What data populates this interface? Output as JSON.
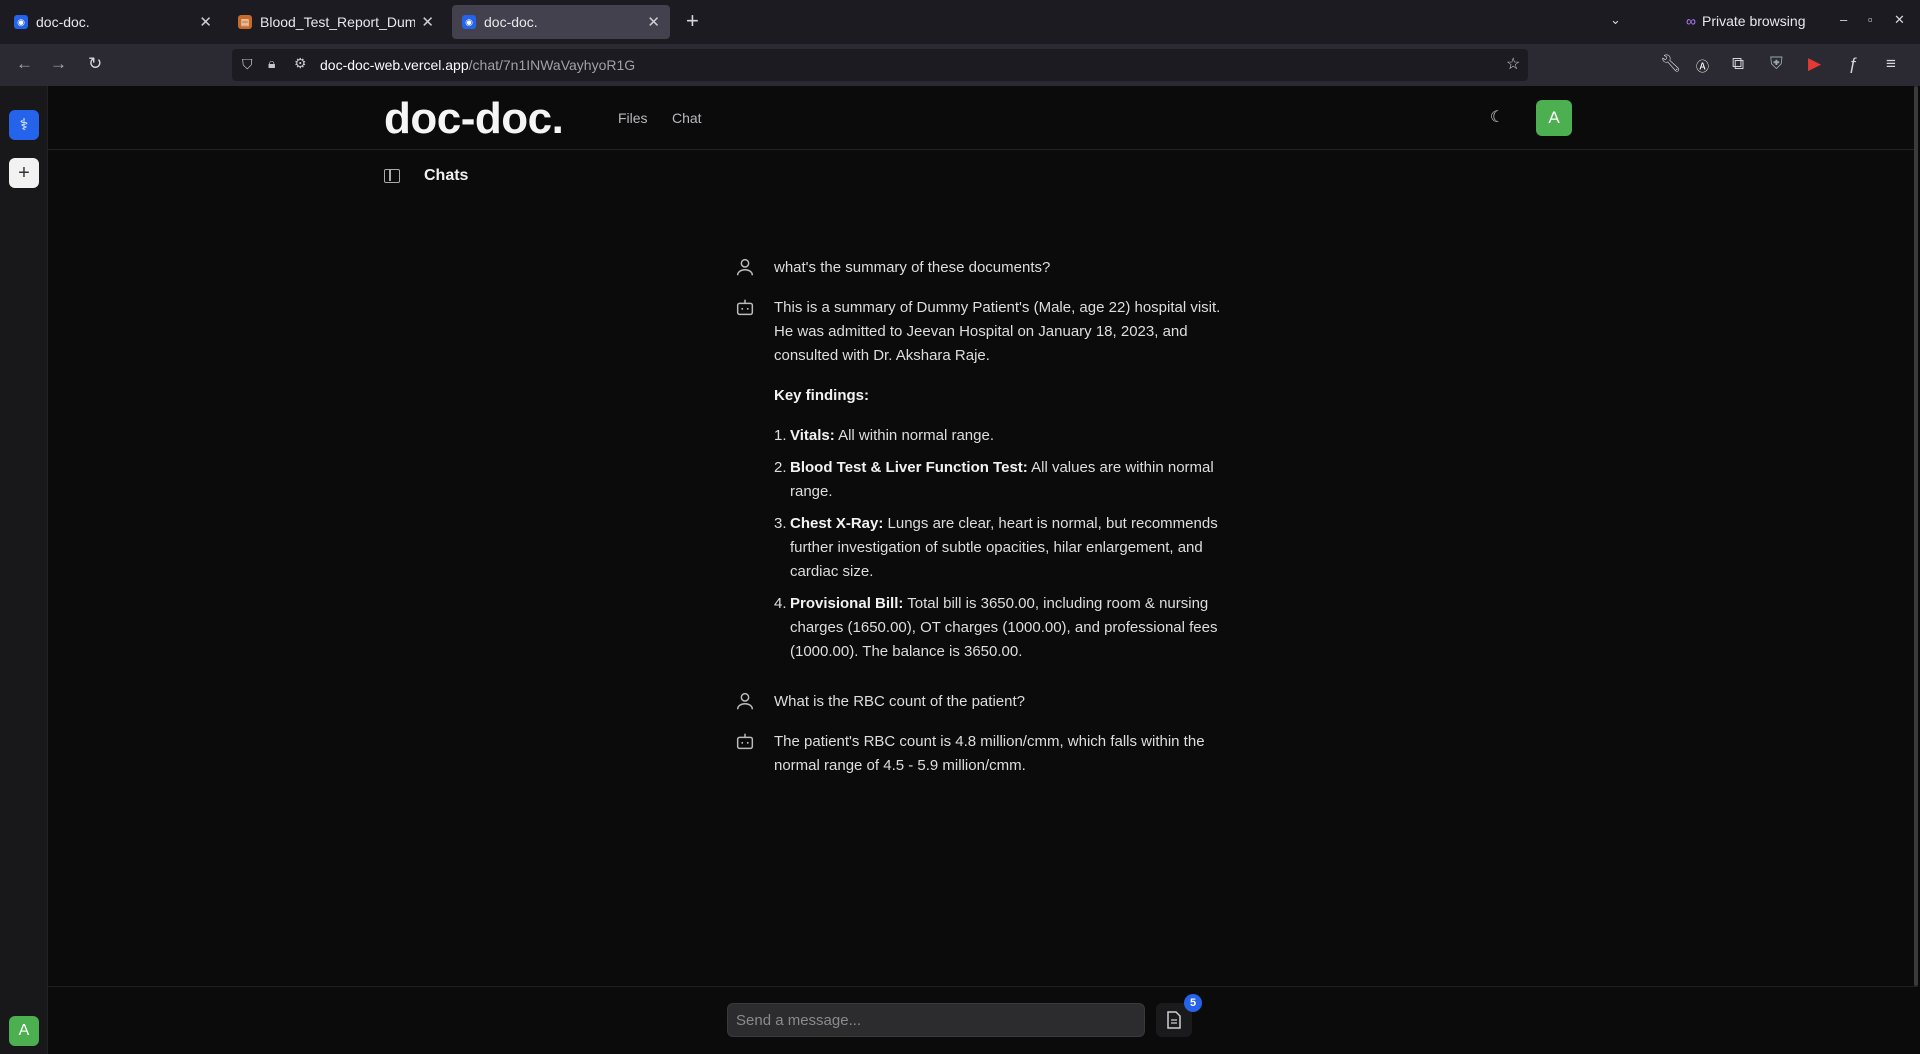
{
  "browser": {
    "tabs": [
      {
        "title": "doc-doc.",
        "active": false
      },
      {
        "title": "Blood_Test_Report_Dum",
        "active": false
      },
      {
        "title": "doc-doc.",
        "active": true
      }
    ],
    "new_tab": "+",
    "private_label": "Private browsing",
    "url_host": "doc-doc-web.vercel.app",
    "url_path": "/chat/7n1INWaVayhyoR1G"
  },
  "rail": {
    "add_label": "+",
    "user_initial": "A"
  },
  "app": {
    "brand": "doc-doc.",
    "nav": {
      "files": "Files",
      "chat": "Chat"
    },
    "avatar_initial": "A",
    "chats_title": "Chats"
  },
  "messages": [
    {
      "role": "user",
      "text": "what's the summary of these documents?"
    },
    {
      "role": "assistant",
      "intro": "This is a summary of Dummy Patient's (Male, age 22) hospital visit. He was admitted to Jeevan Hospital on January 18, 2023, and consulted with Dr. Akshara Raje.",
      "heading": "Key findings:",
      "items": [
        {
          "num": "1.",
          "label": "Vitals:",
          "text": " All within normal range."
        },
        {
          "num": "2.",
          "label": "Blood Test & Liver Function Test:",
          "text": " All values are within normal range."
        },
        {
          "num": "3.",
          "label": "Chest X-Ray:",
          "text": " Lungs are clear, heart is normal, but recommends further investigation of subtle opacities, hilar enlargement, and cardiac size."
        },
        {
          "num": "4.",
          "label": "Provisional Bill:",
          "text": " Total bill is 3650.00, including room & nursing charges (1650.00), OT charges (1000.00), and professional fees (1000.00). The balance is 3650.00."
        }
      ]
    },
    {
      "role": "user",
      "text": "What is the RBC count of the patient?"
    },
    {
      "role": "assistant",
      "text": "The patient's RBC count is 4.8 million/cmm, which falls within the normal range of 4.5 - 5.9 million/cmm."
    }
  ],
  "composer": {
    "placeholder": "Send a message...",
    "files_count": "5"
  },
  "colors": {
    "accent_green": "#4caf50",
    "badge_blue": "#2563eb",
    "rail_blue": "#2563eb"
  }
}
